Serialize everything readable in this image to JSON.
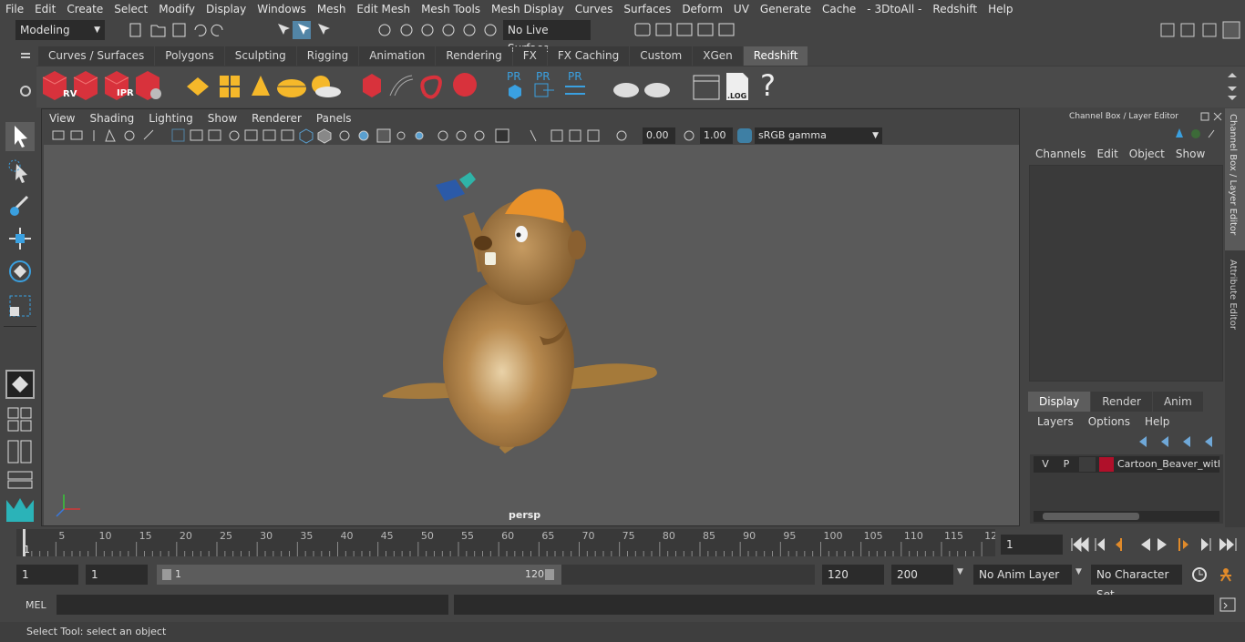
{
  "menu": [
    "File",
    "Edit",
    "Create",
    "Select",
    "Modify",
    "Display",
    "Windows",
    "Mesh",
    "Edit Mesh",
    "Mesh Tools",
    "Mesh Display",
    "Curves",
    "Surfaces",
    "Deform",
    "UV",
    "Generate",
    "Cache",
    "- 3DtoAll -",
    "Redshift",
    "Help"
  ],
  "statusline": {
    "mode": "Modeling",
    "live_surface": "No Live Surface"
  },
  "shelf_tabs": [
    "Curves / Surfaces",
    "Polygons",
    "Sculpting",
    "Rigging",
    "Animation",
    "Rendering",
    "FX",
    "FX Caching",
    "Custom",
    "XGen",
    "Redshift"
  ],
  "shelf_active": "Redshift",
  "shelf_icons": {
    "rv": "RV",
    "ipr": "IPR",
    "pr1": "PR",
    "pr2": "PR",
    "pr3": "PR",
    "log": ".LOG",
    "help": "?"
  },
  "viewport": {
    "menu": [
      "View",
      "Shading",
      "Lighting",
      "Show",
      "Renderer",
      "Panels"
    ],
    "exposure": "0.00",
    "gamma": "1.00",
    "colorspace": "sRGB gamma",
    "camera_label": "persp"
  },
  "channelbox": {
    "title": "Channel Box / Layer Editor",
    "menu": [
      "Channels",
      "Edit",
      "Object",
      "Show"
    ],
    "tabs": [
      "Display",
      "Render",
      "Anim"
    ],
    "active_tab": "Display",
    "layer_menu": [
      "Layers",
      "Options",
      "Help"
    ],
    "layer": {
      "v": "V",
      "p": "P",
      "name": "Cartoon_Beaver_with_",
      "color": "#b0102a"
    }
  },
  "side_tabs": [
    "Channel Box / Layer Editor",
    "Attribute Editor"
  ],
  "timeline": {
    "ticks": [
      "1",
      "5",
      "10",
      "15",
      "20",
      "25",
      "30",
      "35",
      "40",
      "45",
      "50",
      "55",
      "60",
      "65",
      "70",
      "75",
      "80",
      "85",
      "90",
      "95",
      "100",
      "105",
      "110",
      "115",
      "12"
    ],
    "current_frame": "1"
  },
  "range": {
    "start": "1",
    "playback_start": "1",
    "slider_start": "1",
    "slider_end": "120",
    "playback_end": "120",
    "end": "200",
    "anim_layer": "No Anim Layer",
    "character_set": "No Character Set"
  },
  "command": {
    "lang": "MEL"
  },
  "helpline": "Select Tool: select an object",
  "colors": {
    "accent": "#5285a6",
    "bg": "#444444",
    "viewport_bg": "#5a5a5a",
    "redshift_red": "#d8323c"
  }
}
